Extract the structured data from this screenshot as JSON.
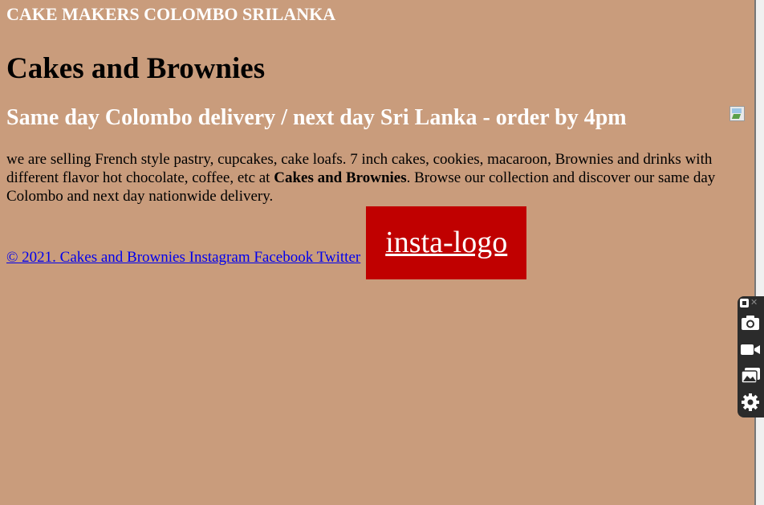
{
  "header": {
    "brand": "CAKE MAKERS COLOMBO SRILANKA",
    "title": "Cakes and Brownies",
    "delivery": "Same day Colombo delivery / next day Sri Lanka - order by 4pm"
  },
  "content": {
    "description_start": "we are selling French style pastry, cupcakes, cake loafs. 7 inch cakes, cookies, macaroon, Brownies and drinks with different flavor hot chocolate, coffee, etc at ",
    "description_bold": "Cakes and Brownies",
    "description_end": ". Browse our collection and discover our same day Colombo and next day nationwide delivery."
  },
  "footer": {
    "links_text": "© 2021. Cakes and Brownies Instagram Facebook Twitter",
    "insta_logo_alt": "insta-logo"
  },
  "toolbar": {
    "icons": [
      "pin-icon",
      "close-icon",
      "camera-icon",
      "video-icon",
      "gallery-icon",
      "gear-icon"
    ]
  },
  "colors": {
    "background": "#c99c7c",
    "brand_text": "#ffffff",
    "link": "#0000ee",
    "insta_box": "#c00000"
  }
}
